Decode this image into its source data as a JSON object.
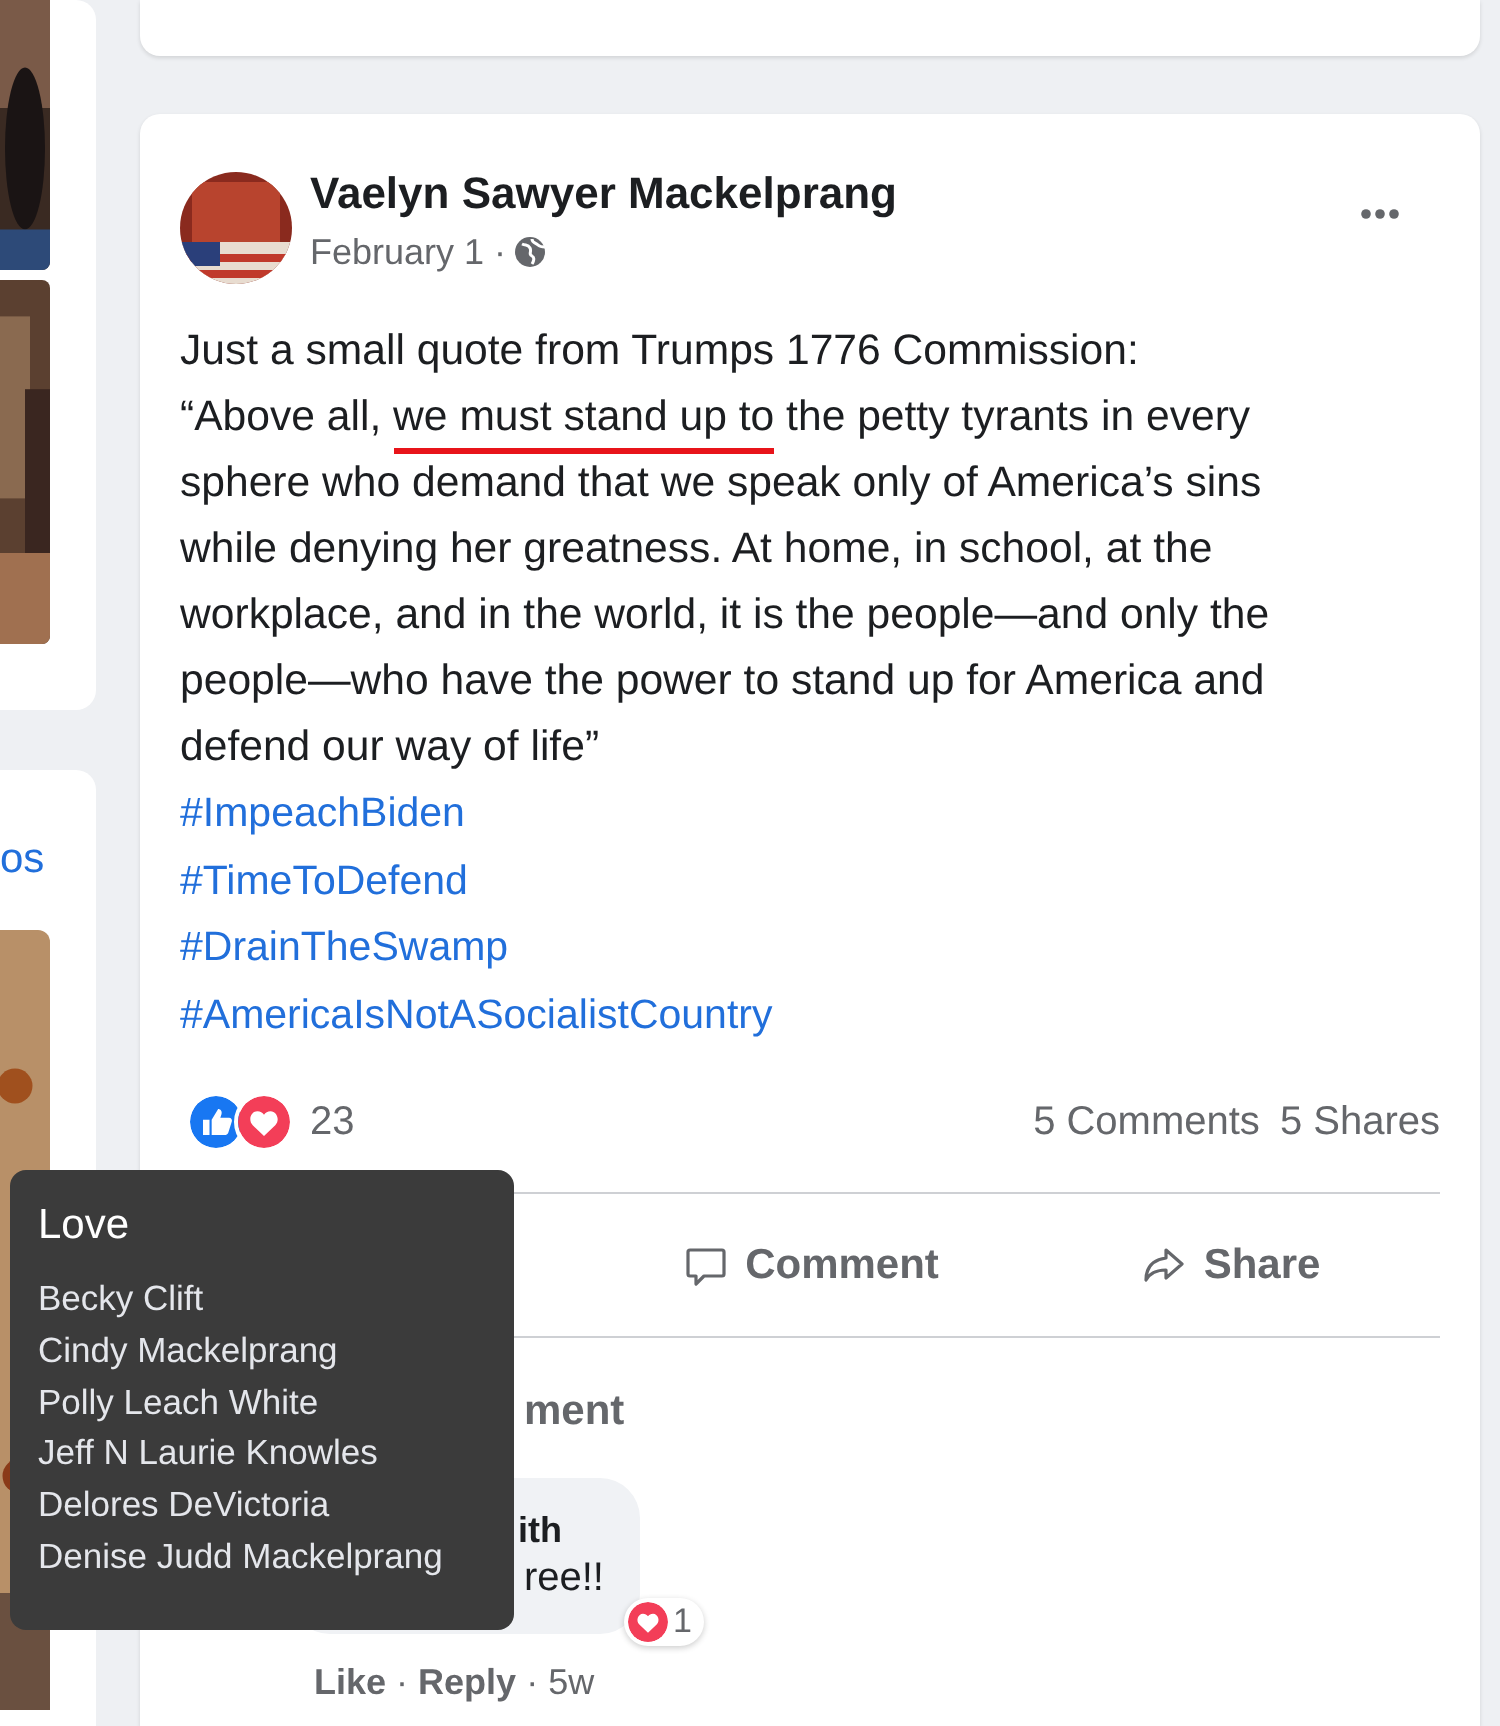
{
  "sidebar": {
    "link": "os"
  },
  "post": {
    "author": "Vaelyn Sawyer Mackelprang",
    "date": "February 1 ·",
    "body": [
      {
        "text": "Just a small quote from Trumps 1776 Commission:\n“Above all, ",
        "marked": false
      },
      {
        "text": "we must stand up to",
        "marked": true
      },
      {
        "text": " the petty tyrants in every sphere who demand that we speak only of America’s sins while denying her greatness. At home, in school, at the workplace, and in the world, it is the people—and only the people—who have the power to stand up for America and defend our way of life”",
        "marked": false
      }
    ],
    "hashtags": [
      "#ImpeachBiden",
      "#TimeToDefend",
      "#DrainTheSwamp",
      "#AmericaIsNotASocialistCountry"
    ],
    "reactions": {
      "icons": [
        {
          "kind": "like"
        },
        {
          "kind": "love"
        }
      ],
      "count": "23"
    },
    "comments_count": "5 Comments",
    "shares_count": "5 Shares",
    "actions": [
      {
        "kind": "comment",
        "label": "Comment"
      },
      {
        "kind": "share",
        "label": "Share"
      }
    ],
    "view_more": "ment",
    "comments": [
      {
        "author": "ith",
        "text": "ree!!",
        "reaction": {
          "kind": "love",
          "count": "1"
        },
        "links": [
          "Like",
          "Reply"
        ],
        "separator": "·",
        "time": "5w"
      }
    ]
  },
  "tooltip": {
    "title": "Love",
    "names": [
      "Becky Clift",
      "Cindy Mackelprang",
      "Polly Leach White",
      "Jeff N Laurie Knowles",
      "Delores DeVictoria",
      "Denise Judd Mackelprang"
    ]
  }
}
